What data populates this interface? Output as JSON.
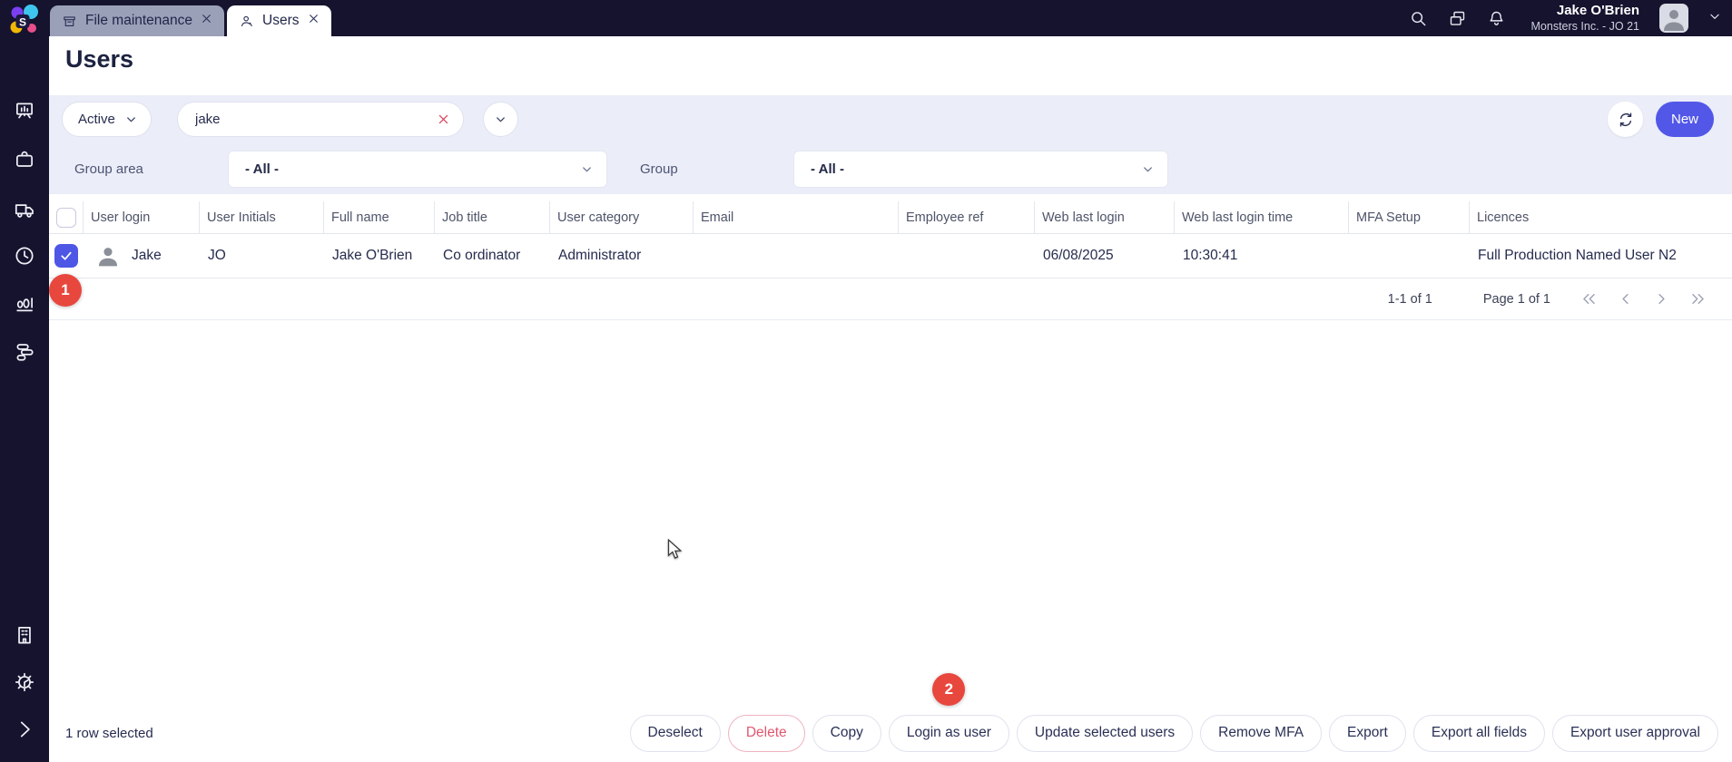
{
  "brand": {
    "logo_letter": "S"
  },
  "topbar": {
    "tabs": [
      {
        "label": "File maintenance"
      },
      {
        "label": "Users"
      }
    ],
    "user": {
      "name": "Jake O'Brien",
      "org": "Monsters Inc. - JO 21"
    }
  },
  "page": {
    "title": "Users"
  },
  "filters": {
    "status": "Active",
    "search_value": "jake",
    "group_area_label": "Group area",
    "group_area_value": "- All -",
    "group_label": "Group",
    "group_value": "- All -",
    "new_button": "New"
  },
  "table": {
    "columns": [
      "User login",
      "User Initials",
      "Full name",
      "Job title",
      "User category",
      "Email",
      "Employee ref",
      "Web last login",
      "Web last login time",
      "MFA Setup",
      "Licences"
    ],
    "rows": [
      {
        "user_login": "Jake",
        "user_initials": "JO",
        "full_name": "Jake O'Brien",
        "job_title": "Co ordinator",
        "user_category": "Administrator",
        "email": "",
        "employee_ref": "",
        "web_last_login": "06/08/2025",
        "web_last_login_time": "10:30:41",
        "mfa_setup": "",
        "licences": "Full Production Named User N2"
      }
    ]
  },
  "pagination": {
    "range": "1-1 of 1",
    "page": "Page 1 of 1"
  },
  "footer": {
    "selection": "1 row selected",
    "buttons": [
      "Deselect",
      "Delete",
      "Copy",
      "Login as user",
      "Update selected users",
      "Remove MFA",
      "Export",
      "Export all fields",
      "Export user approval"
    ]
  },
  "badges": {
    "step1": "1",
    "step2": "2"
  },
  "colors": {
    "accent": "#5257e8",
    "badge_red": "#e8473e",
    "delete_red": "#e2576f",
    "sidebar_navy": "#15132e",
    "filter_lavender": "#ebedf8"
  }
}
